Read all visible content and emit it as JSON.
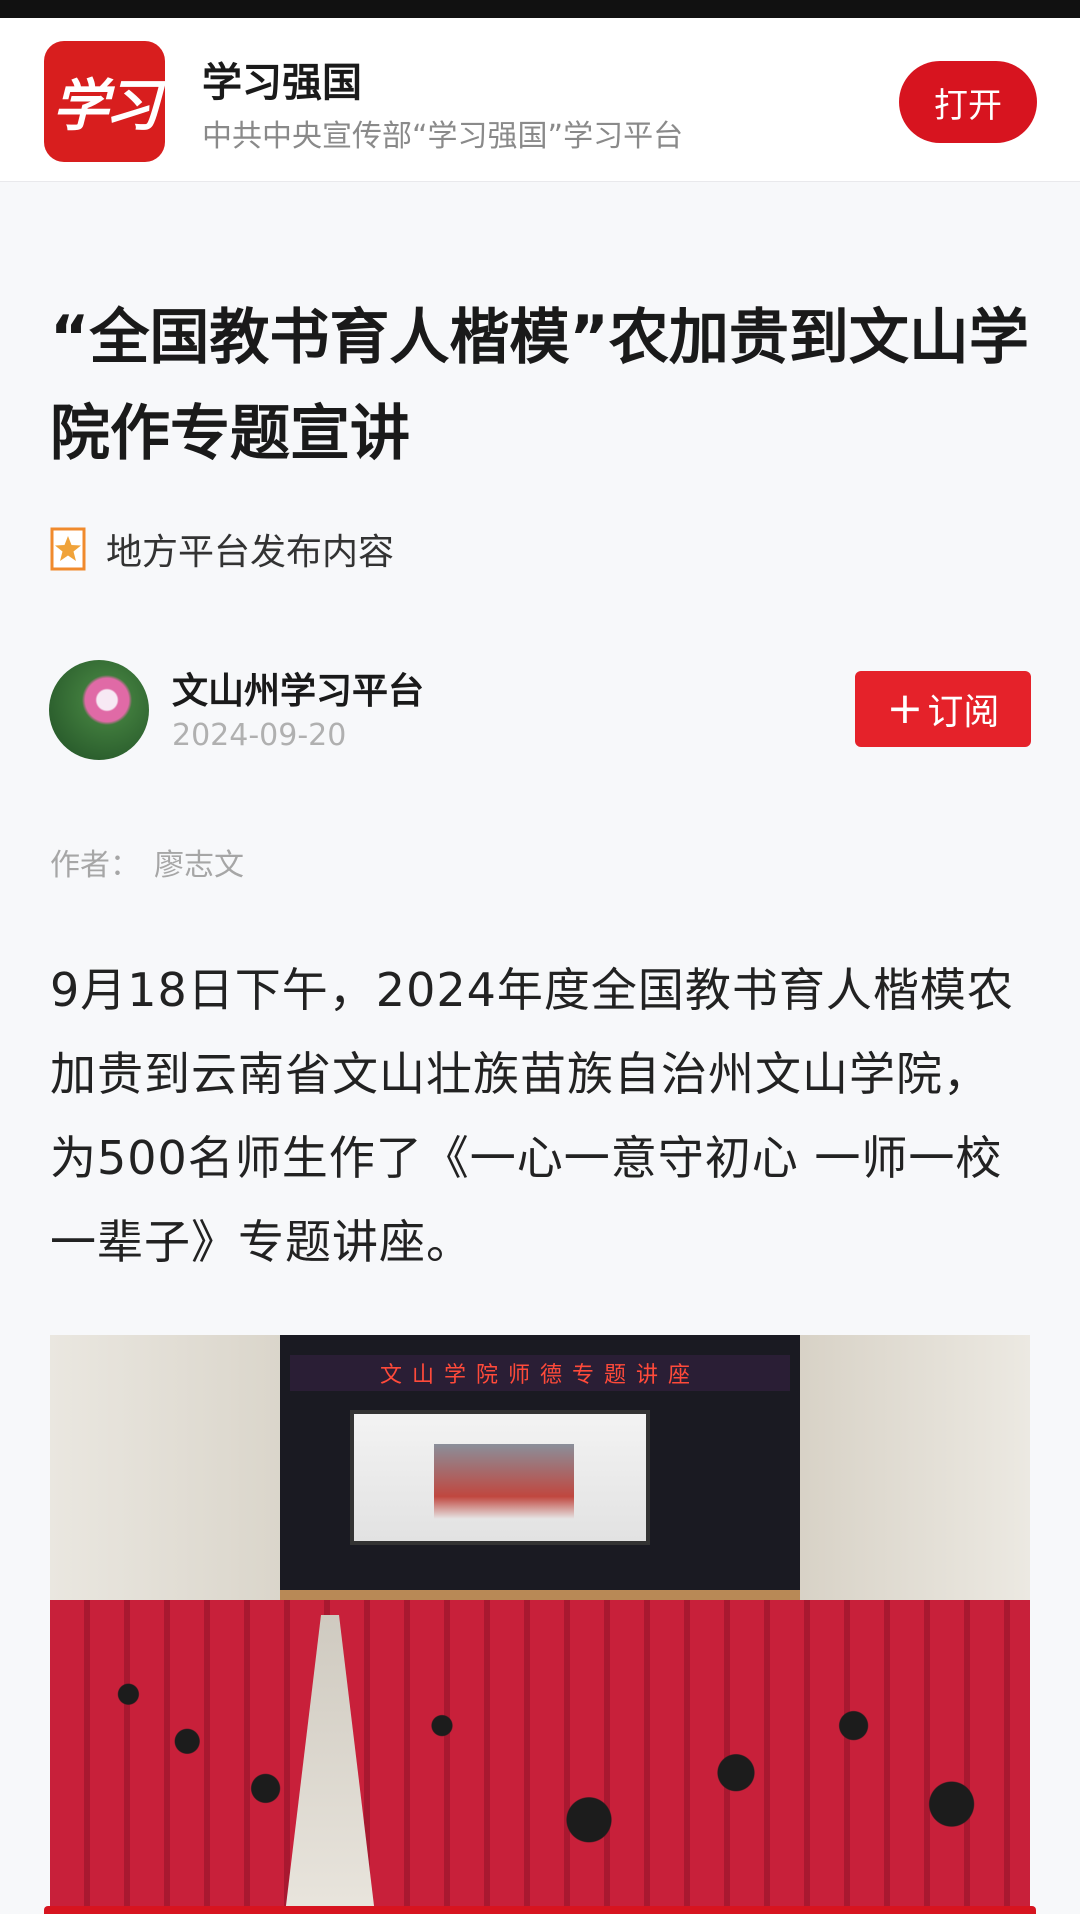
{
  "app_banner": {
    "logo_text": "学习",
    "app_name": "学习强国",
    "app_description": "中共中央宣传部“学习强国”学习平台",
    "open_label": "打开"
  },
  "article": {
    "title": "“全国教书育人楷模”农加贵到文山学院作专题宣讲",
    "source_tag": "地方平台发布内容",
    "channel_name": "文山州学习平台",
    "publish_date": "2024-09-20",
    "subscribe_label": "订阅",
    "byline_label": "作者：",
    "byline_name": "廖志文",
    "body": "9月18日下午，2024年度全国教书育人楷模农加贵到云南省文山壮族苗族自治州文山学院，为500名师生作了《一心一意守初心 一师一校一辈子》专题讲座。",
    "photo_banner_text": "文山学院师德专题讲座"
  },
  "colors": {
    "brand_red": "#d7141f",
    "subscribe_red": "#e5222a",
    "page_background": "#f7f8fa"
  },
  "icons": [
    "star-badge-icon",
    "plus-icon"
  ]
}
